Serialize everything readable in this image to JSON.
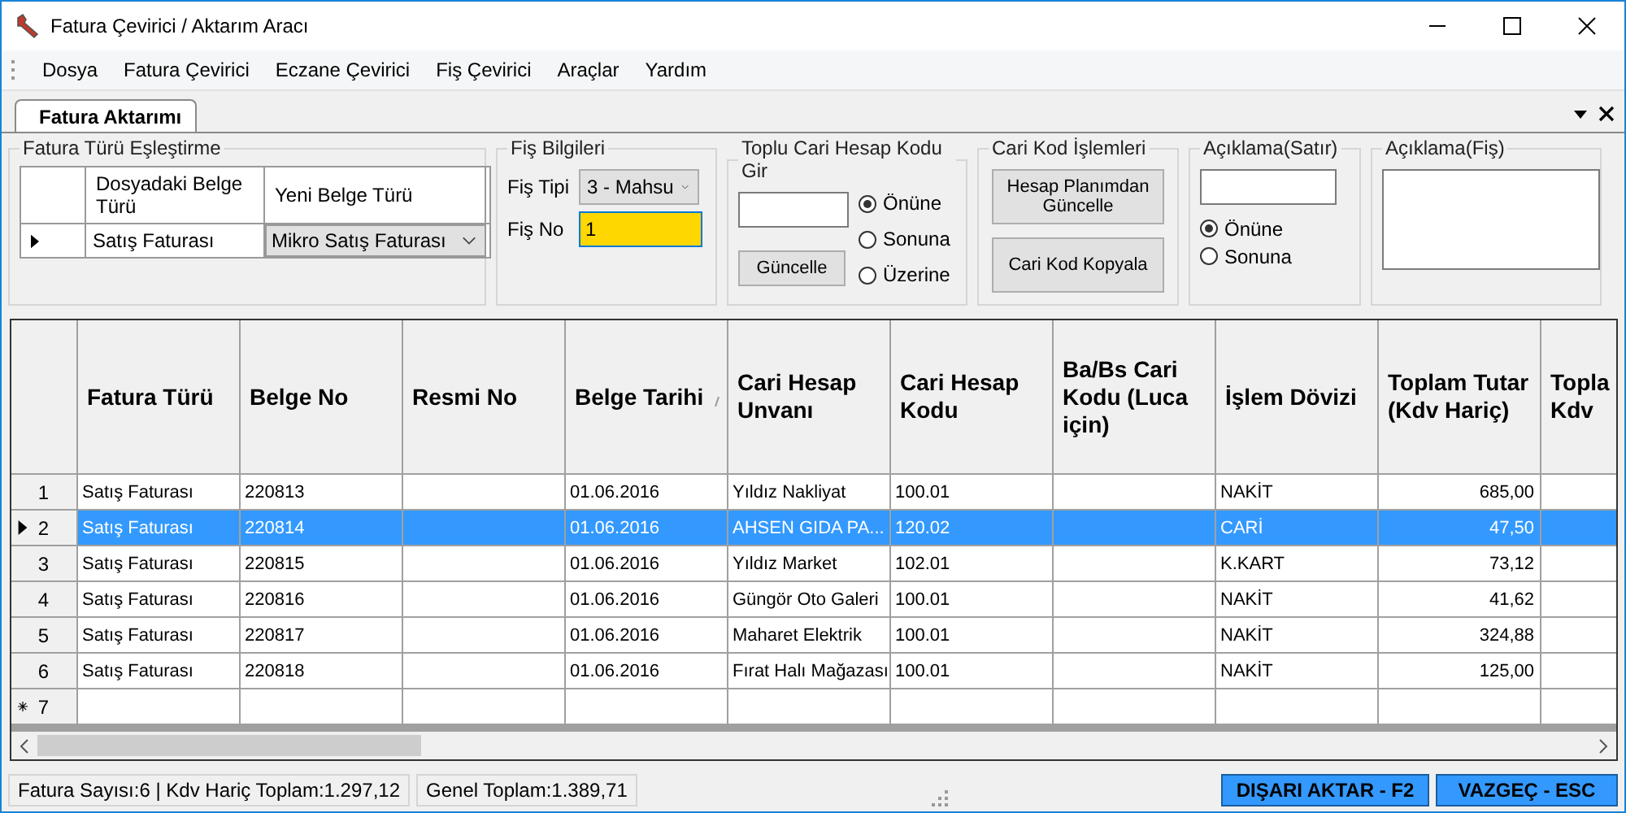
{
  "window": {
    "title": "Fatura Çevirici / Aktarım Aracı"
  },
  "menu": [
    "Dosya",
    "Fatura Çevirici",
    "Eczane Çevirici",
    "Fiş Çevirici",
    "Araçlar",
    "Yardım"
  ],
  "tabs": [
    {
      "label": "Fatura Aktarımı",
      "selected": true
    }
  ],
  "mapping": {
    "title": "Fatura Türü Eşleştirme",
    "columns": [
      "Dosyadaki Belge Türü",
      "Yeni Belge Türü"
    ],
    "rows": [
      {
        "source": "Satış Faturası",
        "target": "Mikro Satış Faturası",
        "selected": true
      }
    ]
  },
  "fis": {
    "title": "Fiş Bilgileri",
    "type_label": "Fiş Tipi",
    "type_value": "3 - Mahsu",
    "no_label": "Fiş No",
    "no_value": "1"
  },
  "bulk": {
    "title": "Toplu Cari Hesap Kodu Gir",
    "button": "Güncelle",
    "options": [
      {
        "label": "Önüne",
        "selected": true
      },
      {
        "label": "Sonuna",
        "selected": false
      },
      {
        "label": "Üzerine",
        "selected": false
      }
    ]
  },
  "cari": {
    "title": "Cari Kod İşlemleri",
    "buttons": [
      "Hesap Planımdan Güncelle",
      "Cari Kod Kopyala"
    ]
  },
  "line_note": {
    "title": "Açıklama(Satır)",
    "options": [
      {
        "label": "Önüne",
        "selected": true
      },
      {
        "label": "Sonuna",
        "selected": false
      }
    ]
  },
  "doc_note": {
    "title": "Açıklama(Fiş)"
  },
  "table": {
    "columns": [
      "Fatura Türü",
      "Belge No",
      "Resmi No",
      "Belge Tarihi",
      "Cari Hesap Unvanı",
      "Cari Hesap Kodu",
      "Ba/Bs Cari Kodu (Luca için)",
      "İşlem Dövizi",
      "Toplam Tutar (Kdv Hariç)",
      "Topla Kdv"
    ],
    "rows": [
      {
        "num": "1",
        "selected": false,
        "kind": "data",
        "cells": [
          "Satış Faturası",
          "220813",
          "",
          "01.06.2016",
          "Yıldız Nakliyat",
          "100.01",
          "",
          "NAKİT",
          "685,00",
          ""
        ]
      },
      {
        "num": "2",
        "selected": true,
        "kind": "data",
        "cells": [
          "Satış Faturası",
          "220814",
          "",
          "01.06.2016",
          "AHSEN GIDA PA...",
          "120.02",
          "",
          "CARİ",
          "47,50",
          ""
        ]
      },
      {
        "num": "3",
        "selected": false,
        "kind": "data",
        "cells": [
          "Satış Faturası",
          "220815",
          "",
          "01.06.2016",
          "Yıldız Market",
          "102.01",
          "",
          "K.KART",
          "73,12",
          ""
        ]
      },
      {
        "num": "4",
        "selected": false,
        "kind": "data",
        "cells": [
          "Satış Faturası",
          "220816",
          "",
          "01.06.2016",
          "Güngör Oto Galeri",
          "100.01",
          "",
          "NAKİT",
          "41,62",
          ""
        ]
      },
      {
        "num": "5",
        "selected": false,
        "kind": "data",
        "cells": [
          "Satış Faturası",
          "220817",
          "",
          "01.06.2016",
          "Maharet Elektrik",
          "100.01",
          "",
          "NAKİT",
          "324,88",
          ""
        ]
      },
      {
        "num": "6",
        "selected": false,
        "kind": "data",
        "cells": [
          "Satış Faturası",
          "220818",
          "",
          "01.06.2016",
          "Fırat Halı Mağazası",
          "100.01",
          "",
          "NAKİT",
          "125,00",
          ""
        ]
      },
      {
        "num": "7",
        "selected": false,
        "kind": "new",
        "cells": [
          "",
          "",
          "",
          "",
          "",
          "",
          "",
          "",
          "",
          ""
        ]
      }
    ]
  },
  "status": [
    "Fatura Sayısı:6 | Kdv Hariç Toplam:1.297,12",
    "Genel Toplam:1.389,71"
  ],
  "actions": [
    "DIŞARI AKTAR - F2",
    "VAZGEÇ - ESC"
  ]
}
